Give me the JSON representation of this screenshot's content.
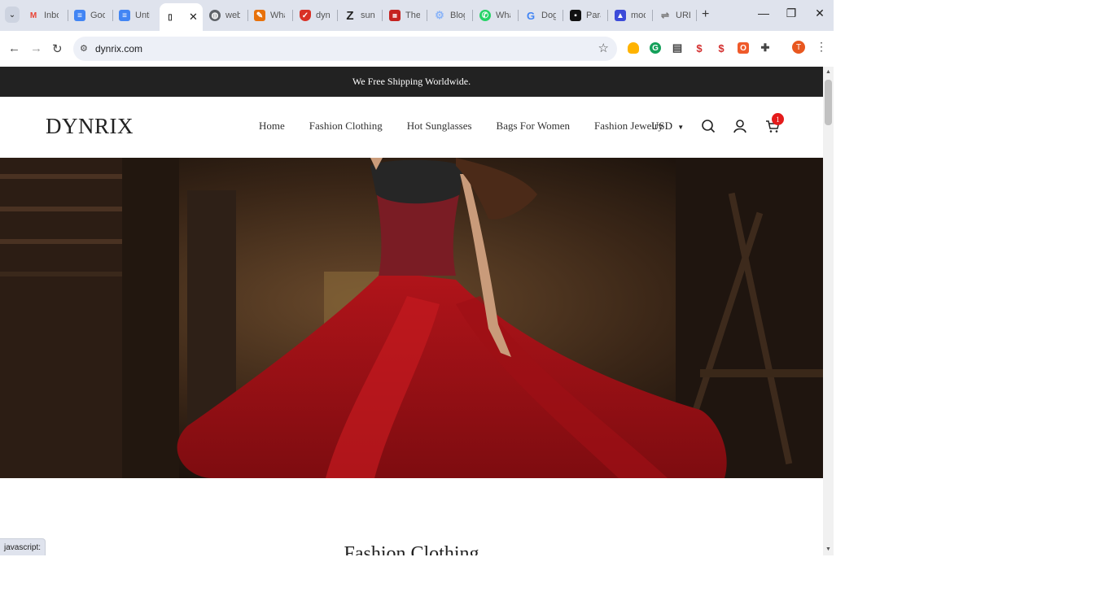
{
  "browser": {
    "tabs": [
      {
        "title": "Inbo",
        "favicon": "gmail-icon",
        "color": "#ea4335",
        "glyph": "M"
      },
      {
        "title": "Goo",
        "favicon": "google-docs-icon",
        "color": "#4285f4",
        "glyph": ""
      },
      {
        "title": "Unti",
        "favicon": "google-docs-icon",
        "color": "#4285f4",
        "glyph": ""
      },
      {
        "title": "",
        "favicon": "",
        "color": "",
        "glyph": "",
        "active": true
      },
      {
        "title": "webs",
        "favicon": "globe-icon",
        "color": "#5f6368",
        "glyph": ""
      },
      {
        "title": "What",
        "favicon": "app-icon",
        "color": "#e8710a",
        "glyph": ""
      },
      {
        "title": "dynr",
        "favicon": "shield-icon",
        "color": "#d93025",
        "glyph": ""
      },
      {
        "title": "sung",
        "favicon": "z-icon",
        "color": "#222222",
        "glyph": "Z"
      },
      {
        "title": "The",
        "favicon": "news-icon",
        "color": "#c5221f",
        "glyph": ""
      },
      {
        "title": "Blog",
        "favicon": "gear-icon",
        "color": "#8ab4f8",
        "glyph": ""
      },
      {
        "title": "What",
        "favicon": "whatsapp-icon",
        "color": "#25d366",
        "glyph": ""
      },
      {
        "title": "Doge",
        "favicon": "google-icon",
        "color": "#4285f4",
        "glyph": "G"
      },
      {
        "title": "Para",
        "favicon": "app-icon",
        "color": "#111111",
        "glyph": ""
      },
      {
        "title": "mod",
        "favicon": "app-icon",
        "color": "#3c4bd9",
        "glyph": ""
      },
      {
        "title": "URL",
        "favicon": "link-icon",
        "color": "#777777",
        "glyph": ""
      }
    ],
    "active_tab_close": "✕",
    "new_tab": "+",
    "url": "dynrix.com",
    "profile_initial": "T",
    "status_text": "javascript:"
  },
  "site": {
    "announcement": "We Free Shipping Worldwide.",
    "logo": "DYNRIX",
    "nav": [
      "Home",
      "Fashion Clothing",
      "Hot Sunglasses",
      "Bags For Women",
      "Fashion Jewelry"
    ],
    "currency": "USD",
    "cart_count": "1",
    "section_title": "Fashion Clothing"
  },
  "colors": {
    "announcement_bg": "#222222",
    "cart_badge": "#e41b1b",
    "tab_strip": "#dfe3ed"
  }
}
